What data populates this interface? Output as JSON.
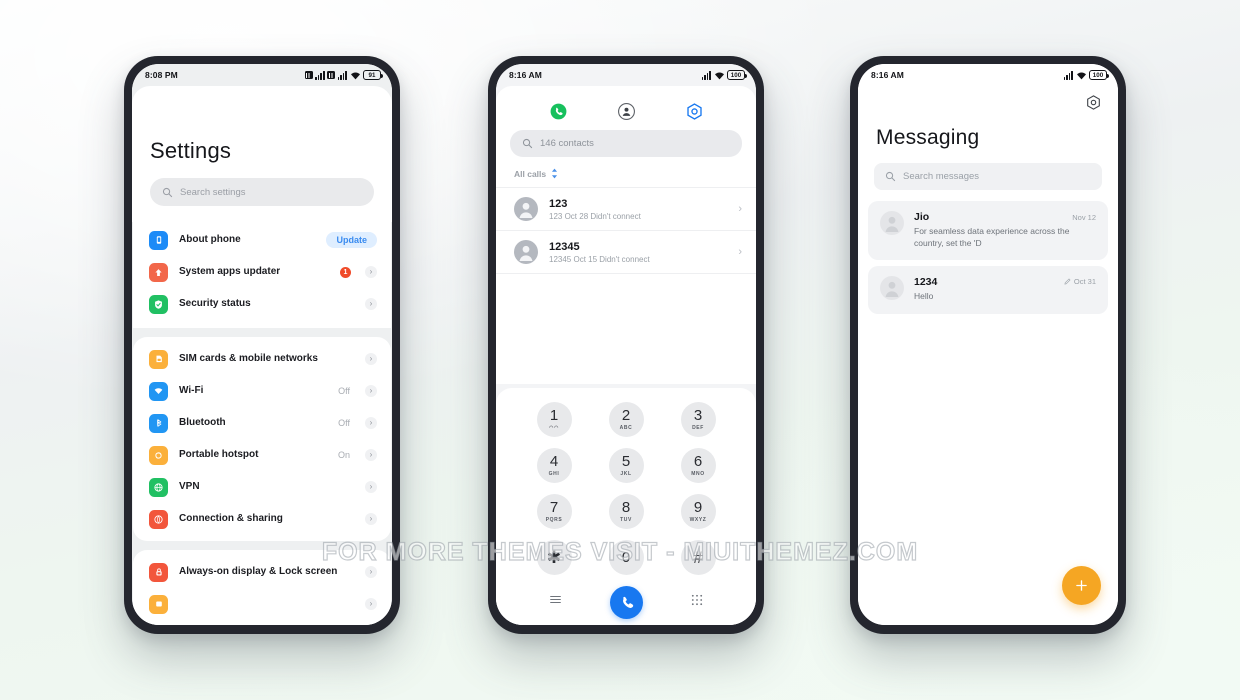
{
  "watermark": "FOR MORE THEMES VISIT - MIUITHEMEZ.COM",
  "colors": {
    "accent_blue": "#1878f0",
    "accent_orange": "#f5a623",
    "badge_red": "#f04b2a",
    "pill_bg": "#dfeeff",
    "pill_text": "#3b8cf0",
    "frame": "#24262e",
    "page_bg": "#eef1f2"
  },
  "phone1": {
    "status_bar": {
      "time": "8:08 PM",
      "battery": "91",
      "icons": [
        "sim1-signal-icon",
        "sim2-signal-icon",
        "wifi-icon",
        "battery-icon"
      ]
    },
    "title": "Settings",
    "search": {
      "placeholder": "Search settings",
      "icon": "search-icon"
    },
    "groups": [
      {
        "items": [
          {
            "label": "About phone",
            "icon": "phone-info-icon",
            "icon_color": "#1d8bf7",
            "pill": "Update",
            "chevron": false,
            "badge": ""
          },
          {
            "label": "System apps updater",
            "icon": "up-arrow-icon",
            "icon_color": "#f2674a",
            "pill": "",
            "chevron": true,
            "badge": "1"
          },
          {
            "label": "Security status",
            "icon": "shield-check-icon",
            "icon_color": "#21c063",
            "pill": "",
            "chevron": true,
            "badge": ""
          }
        ]
      },
      {
        "items": [
          {
            "label": "SIM cards & mobile networks",
            "icon": "sim-card-icon",
            "icon_color": "#fbb03b",
            "value": "",
            "chevron": true
          },
          {
            "label": "Wi-Fi",
            "icon": "wifi-icon",
            "icon_color": "#2196f3",
            "value": "Off",
            "chevron": true
          },
          {
            "label": "Bluetooth",
            "icon": "bluetooth-icon",
            "icon_color": "#2196f3",
            "value": "Off",
            "chevron": true
          },
          {
            "label": "Portable hotspot",
            "icon": "hotspot-icon",
            "icon_color": "#fbb03b",
            "value": "On",
            "chevron": true
          },
          {
            "label": "VPN",
            "icon": "globe-icon",
            "icon_color": "#21c063",
            "value": "",
            "chevron": true
          },
          {
            "label": "Connection & sharing",
            "icon": "share-icon",
            "icon_color": "#f2563c",
            "value": "",
            "chevron": true
          }
        ]
      },
      {
        "items": [
          {
            "label": "Always-on display & Lock screen",
            "icon": "lock-icon",
            "icon_color": "#f2563c",
            "value": "",
            "chevron": true
          },
          {
            "label": "",
            "icon": "display-icon",
            "icon_color": "#fbb03b",
            "value": "",
            "chevron": true
          }
        ]
      }
    ]
  },
  "phone2": {
    "status_bar": {
      "time": "8:16 AM",
      "battery": "100",
      "icons": [
        "signal-icon",
        "wifi-icon",
        "battery-icon"
      ]
    },
    "tabs": [
      {
        "name": "tab-keypad",
        "icon": "phone-handset-icon",
        "active": true
      },
      {
        "name": "tab-contacts",
        "icon": "person-circle-icon",
        "active": false
      },
      {
        "name": "tab-settings",
        "icon": "gear-hex-icon",
        "active": false
      }
    ],
    "search": {
      "placeholder": "146 contacts",
      "icon": "search-icon"
    },
    "filter": {
      "label": "All calls",
      "icon": "sort-updown-icon"
    },
    "calls": [
      {
        "name": "123",
        "meta": "123  Oct 28 Didn't connect",
        "avatar": "person-avatar",
        "chevron": "›"
      },
      {
        "name": "12345",
        "meta": "12345  Oct 15 Didn't connect",
        "avatar": "person-avatar",
        "chevron": "›"
      }
    ],
    "keypad": [
      {
        "num": "1",
        "sub": "◠◠"
      },
      {
        "num": "2",
        "sub": "ABC"
      },
      {
        "num": "3",
        "sub": "DEF"
      },
      {
        "num": "4",
        "sub": "GHI"
      },
      {
        "num": "5",
        "sub": "JKL"
      },
      {
        "num": "6",
        "sub": "MNO"
      },
      {
        "num": "7",
        "sub": "PQRS"
      },
      {
        "num": "8",
        "sub": "TUV"
      },
      {
        "num": "9",
        "sub": "WXYZ"
      },
      {
        "num": "✱",
        "sub": ""
      },
      {
        "num": "0",
        "sub": "+"
      },
      {
        "num": "#",
        "sub": ""
      }
    ],
    "bottom_bar": [
      {
        "name": "menu-button",
        "icon": "hamburger-icon"
      },
      {
        "name": "call-button",
        "icon": "phone-handset-icon"
      },
      {
        "name": "dialpad-button",
        "icon": "dialpad-icon"
      }
    ]
  },
  "phone3": {
    "status_bar": {
      "time": "8:16 AM",
      "battery": "100",
      "icons": [
        "signal-icon",
        "wifi-icon",
        "battery-icon"
      ]
    },
    "gear_icon": "gear-hex-icon",
    "title": "Messaging",
    "search": {
      "placeholder": "Search messages",
      "icon": "search-icon"
    },
    "threads": [
      {
        "name": "Jio",
        "time": "Nov 12",
        "preview": "For seamless data experience across the country, set the 'D",
        "sent_icon": false,
        "avatar": "person-avatar"
      },
      {
        "name": "1234",
        "time": "Oct 31",
        "preview": "Hello",
        "sent_icon": true,
        "avatar": "person-avatar"
      }
    ],
    "fab": {
      "label": "+",
      "name": "new-message-fab"
    }
  }
}
